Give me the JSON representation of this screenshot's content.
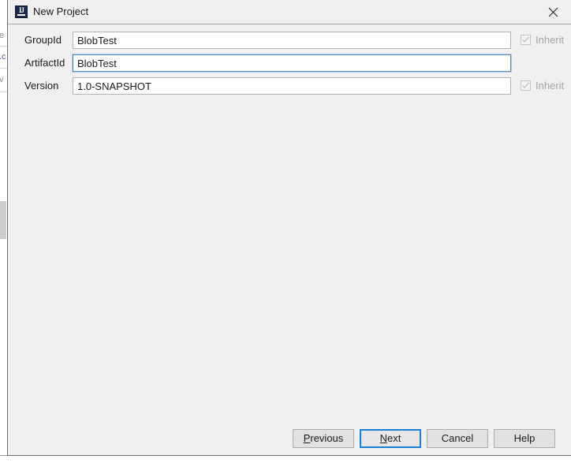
{
  "window": {
    "title": "New Project",
    "app_icon": "intellij-idea-icon",
    "close_icon": "close-icon"
  },
  "form": {
    "fields": [
      {
        "label": "GroupId",
        "value": "BlobTest",
        "placeholder": "",
        "focused": false,
        "inherit": {
          "label": "Inherit",
          "checked": true,
          "enabled": false
        }
      },
      {
        "label": "ArtifactId",
        "value": "BlobTest",
        "placeholder": "",
        "focused": true,
        "inherit": null
      },
      {
        "label": "Version",
        "value": "1.0-SNAPSHOT",
        "placeholder": "",
        "focused": false,
        "inherit": {
          "label": "Inherit",
          "checked": true,
          "enabled": false
        }
      }
    ]
  },
  "buttons": {
    "previous": {
      "label": "Previous",
      "mnemonic": "P"
    },
    "next": {
      "label": "Next",
      "mnemonic": "N",
      "default": true
    },
    "cancel": {
      "label": "Cancel"
    },
    "help": {
      "label": "Help"
    }
  },
  "background_window": {
    "fragments": [
      "e",
      ".c",
      "v"
    ]
  },
  "colors": {
    "dialog_bg": "#f0f0f0",
    "field_bg": "#ffffff",
    "focus_blue": "#1d7fd4",
    "field_focus_border": "#4a90c4",
    "disabled_text": "#a6a6a6",
    "text": "#1a1a1a",
    "button_bg": "#e1e1e1",
    "border": "#adadad"
  }
}
